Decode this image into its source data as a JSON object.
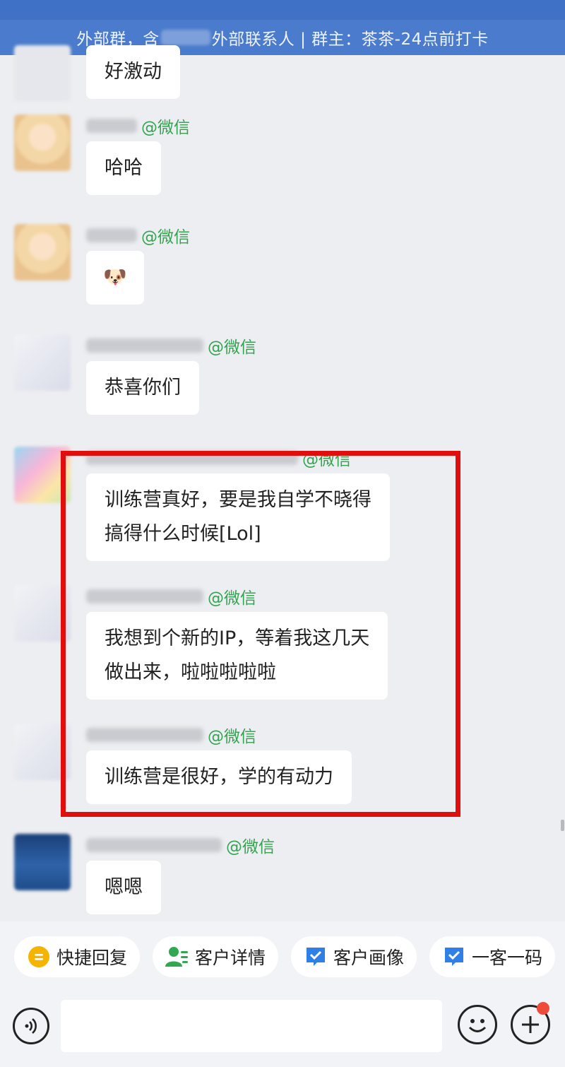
{
  "header": {
    "title_prefix": "外部群，含",
    "title_suffix": "外部联系人 | 群主：茶茶-24点前打卡"
  },
  "messages": [
    {
      "sender_tag": "",
      "text": "好激动"
    },
    {
      "sender_tag": "@微信",
      "text": "哈哈"
    },
    {
      "sender_tag": "@微信",
      "text": "🐶"
    },
    {
      "sender_tag": "@微信",
      "text": "恭喜你们"
    },
    {
      "sender_tag": "@微信",
      "text_line1": "训练营真好，要是我自学不晓得",
      "text_line2": "搞得什么时候[Lol]"
    },
    {
      "sender_tag": "@微信",
      "text_line1": "我想到个新的IP，等着我这几天",
      "text_line2": "做出来，啦啦啦啦啦"
    },
    {
      "sender_tag": "@微信",
      "text": "训练营是很好，学的有动力"
    },
    {
      "sender_tag": "@微信",
      "text": "嗯嗯"
    }
  ],
  "quick_actions": [
    {
      "label": "快捷回复",
      "icon": "quick-reply-icon",
      "color": "#f5b400"
    },
    {
      "label": "客户详情",
      "icon": "customer-detail-icon",
      "color": "#2fa84f"
    },
    {
      "label": "客户画像",
      "icon": "customer-profile-icon",
      "color": "#2f7fe8"
    },
    {
      "label": "一客一码",
      "icon": "qr-code-icon",
      "color": "#2f7fe8"
    }
  ],
  "colors": {
    "header": "#4b7bcc",
    "wechat_tag": "#33a350",
    "highlight": "#e10e0e",
    "badge": "#ee4b3c"
  }
}
